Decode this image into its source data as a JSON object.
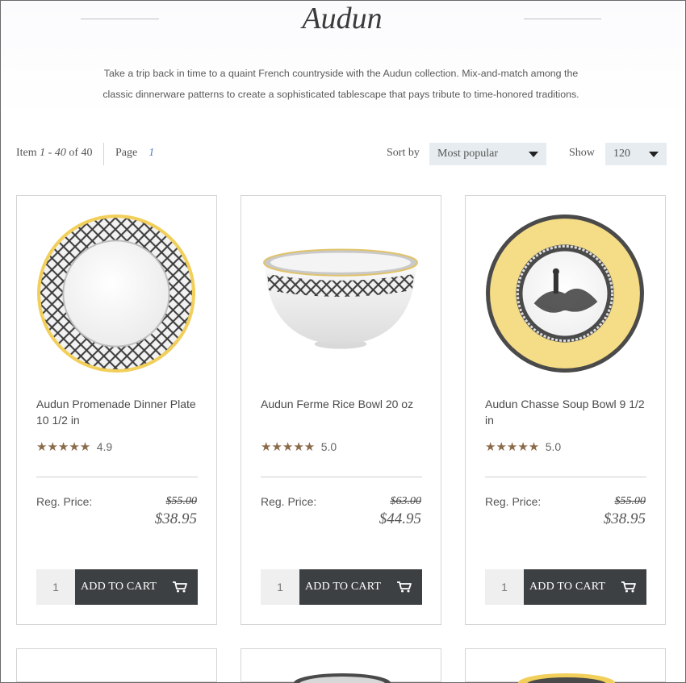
{
  "collection": {
    "title": "Audun",
    "description_line1": "Take a trip back in time to a quaint French countryside with the Audun collection. Mix-and-match among the",
    "description_line2": "classic dinnerware patterns to create a sophisticated tablescape that pays tribute to time-honored traditions."
  },
  "toolbar": {
    "item_label": "Item",
    "item_range_start": "1",
    "item_range_sep": " - ",
    "item_range_end": "40",
    "item_of": "of 40",
    "page_label": "Page",
    "page_number": "1",
    "sort_label": "Sort by",
    "sort_value": "Most popular",
    "show_label": "Show",
    "show_value": "120"
  },
  "products": [
    {
      "name": "Audun Promenade Dinner Plate 10 1/2 in",
      "stars": "★★★★★",
      "rating": "4.9",
      "reg_label": "Reg. Price:",
      "original_price": "$55.00",
      "sale_price": "$38.95",
      "quantity": "1",
      "button_label": "ADD TO CART",
      "image_icon": "dinner-plate-icon"
    },
    {
      "name": "Audun Ferme Rice Bowl 20 oz",
      "stars": "★★★★★",
      "rating": "5.0",
      "reg_label": "Reg. Price:",
      "original_price": "$63.00",
      "sale_price": "$44.95",
      "quantity": "1",
      "button_label": "ADD TO CART",
      "image_icon": "rice-bowl-icon"
    },
    {
      "name": "Audun Chasse Soup Bowl 9 1/2 in",
      "stars": "★★★★★",
      "rating": "5.0",
      "reg_label": "Reg. Price:",
      "original_price": "$55.00",
      "sale_price": "$38.95",
      "quantity": "1",
      "button_label": "ADD TO CART",
      "image_icon": "soup-bowl-icon"
    }
  ],
  "colors": {
    "button_bg": "#3d4042",
    "star": "#8b6a4a",
    "page_link": "#4a7fc1",
    "select_bg": "#e6ecef",
    "plate_yellow": "#f5dc86"
  }
}
